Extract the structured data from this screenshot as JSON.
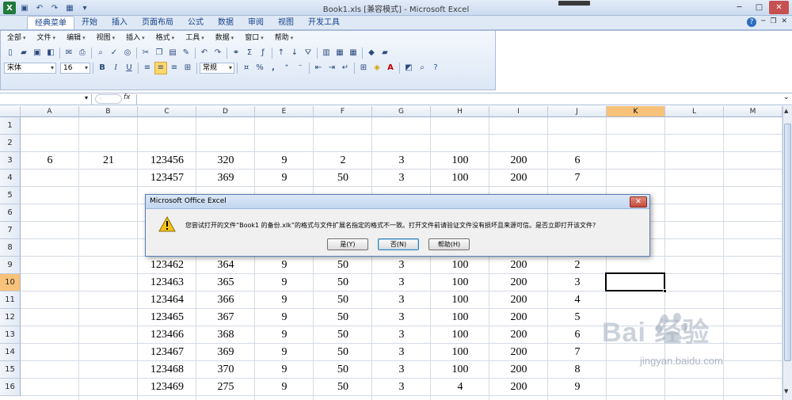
{
  "window": {
    "title": "Book1.xls  [兼容模式] - Microsoft Excel"
  },
  "ribbon_tabs": [
    "经典菜单",
    "开始",
    "插入",
    "页面布局",
    "公式",
    "数据",
    "审阅",
    "视图",
    "开发工具"
  ],
  "classic_menu": [
    {
      "label": "全部"
    },
    {
      "label": "文件"
    },
    {
      "label": "编辑"
    },
    {
      "label": "视图"
    },
    {
      "label": "插入"
    },
    {
      "label": "格式"
    },
    {
      "label": "工具"
    },
    {
      "label": "数据"
    },
    {
      "label": "窗口"
    },
    {
      "label": "帮助"
    }
  ],
  "format_bar": {
    "font_name": "宋体",
    "font_size": "16",
    "number_format": "常规",
    "bold": "B",
    "italic": "I",
    "underline": "U",
    "percent": "%",
    "comma": ","
  },
  "formula_bar": {
    "fx": "fx"
  },
  "columns": [
    "A",
    "B",
    "C",
    "D",
    "E",
    "F",
    "G",
    "H",
    "I",
    "J",
    "K",
    "L",
    "M"
  ],
  "active_column": "K",
  "rows": [
    "1",
    "2",
    "3",
    "4",
    "5",
    "6",
    "7",
    "8",
    "9",
    "10",
    "11",
    "12",
    "13",
    "14",
    "15",
    "16"
  ],
  "active_row": "10",
  "cells": {
    "r3": [
      "6",
      "21",
      "123456",
      "320",
      "9",
      "2",
      "3",
      "100",
      "200",
      "6"
    ],
    "r4": [
      "",
      "",
      "123457",
      "369",
      "9",
      "50",
      "3",
      "100",
      "200",
      "7"
    ],
    "r9": [
      "",
      "",
      "123462",
      "364",
      "9",
      "50",
      "3",
      "100",
      "200",
      "2"
    ],
    "r10": [
      "",
      "",
      "123463",
      "365",
      "9",
      "50",
      "3",
      "100",
      "200",
      "3"
    ],
    "r11": [
      "",
      "",
      "123464",
      "366",
      "9",
      "50",
      "3",
      "100",
      "200",
      "4"
    ],
    "r12": [
      "",
      "",
      "123465",
      "367",
      "9",
      "50",
      "3",
      "100",
      "200",
      "5"
    ],
    "r13": [
      "",
      "",
      "123466",
      "368",
      "9",
      "50",
      "3",
      "100",
      "200",
      "6"
    ],
    "r14": [
      "",
      "",
      "123467",
      "369",
      "9",
      "50",
      "3",
      "100",
      "200",
      "7"
    ],
    "r15": [
      "",
      "",
      "123468",
      "370",
      "9",
      "50",
      "3",
      "100",
      "200",
      "8"
    ],
    "r16": [
      "",
      "",
      "123469",
      "275",
      "9",
      "50",
      "3",
      "4",
      "200",
      "9"
    ]
  },
  "dialog": {
    "title": "Microsoft Office Excel",
    "message": "您尝试打开的文件“Book1 的备份.xlk”的格式与文件扩展名指定的格式不一致。打开文件前请验证文件没有损坏且来源可信。是否立即打开该文件?",
    "buttons": {
      "yes": "是(Y)",
      "no": "否(N)",
      "help": "帮助(H)"
    },
    "icon": "warning-icon"
  },
  "watermark": {
    "brand": "Bai   经验",
    "url": "jingyan.baidu.com"
  }
}
